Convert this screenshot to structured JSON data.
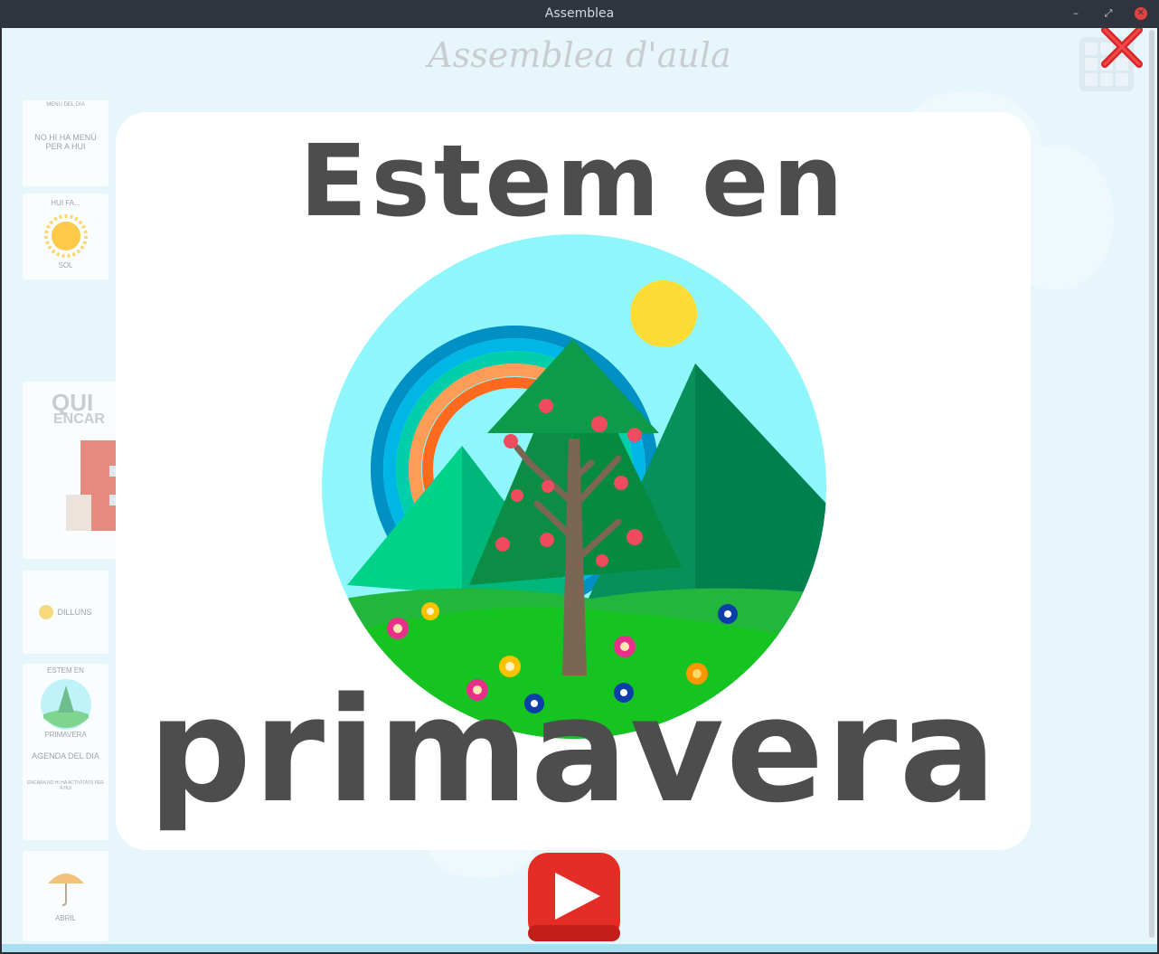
{
  "window": {
    "title": "Assemblea",
    "min_icon": "minimize-icon",
    "max_icon": "maximize-icon",
    "close_icon": "window-close-icon"
  },
  "app": {
    "title": "Assemblea d'aula"
  },
  "sidebar": {
    "menu_header": "MENÚ DEL DIA",
    "menu_text": "NO HI HA MENÚ PER A HUI",
    "weather_header": "HUI FA...",
    "weather_label": "SOL",
    "tasks_title_1": "QUI",
    "tasks_title_2": "ENCAR",
    "day_label": "DILLUNS",
    "season_header": "ESTEM EN",
    "season_label": "PRIMAVERA",
    "agenda_header": "AGENDA DEL DIA",
    "agenda_text": "ENCARA NO HI HA ACTIVITATS PER A HUI",
    "month_label": "ABRIL"
  },
  "modal": {
    "headline": "Estem en",
    "season": "primavera",
    "play_icon": "play-icon"
  },
  "colors": {
    "accent_red": "#e53935",
    "text_dark": "#4d4d4d",
    "sky": "#8ff7fc"
  }
}
